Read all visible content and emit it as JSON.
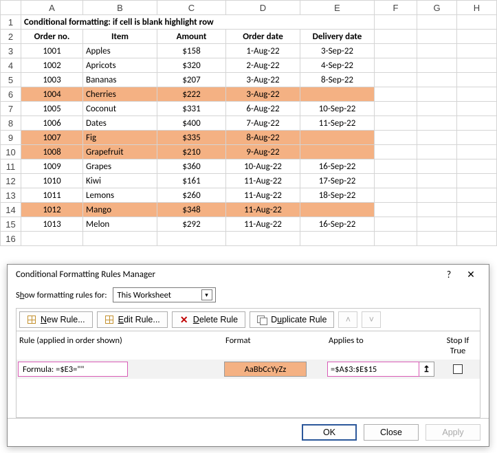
{
  "columns": [
    "A",
    "B",
    "C",
    "D",
    "E",
    "F",
    "G",
    "H"
  ],
  "title": "Conditional formatting: if cell is blank highlight row",
  "headers": {
    "order": "Order no.",
    "item": "Item",
    "amount": "Amount",
    "odate": "Order date",
    "ddate": "Delivery date"
  },
  "rows": [
    {
      "n": "3",
      "order": "1001",
      "item": "Apples",
      "amount": "$158",
      "odate": "1-Aug-22",
      "ddate": "3-Sep-22",
      "hl": false
    },
    {
      "n": "4",
      "order": "1002",
      "item": "Apricots",
      "amount": "$320",
      "odate": "2-Aug-22",
      "ddate": "4-Sep-22",
      "hl": false
    },
    {
      "n": "5",
      "order": "1003",
      "item": "Bananas",
      "amount": "$207",
      "odate": "3-Aug-22",
      "ddate": "8-Sep-22",
      "hl": false
    },
    {
      "n": "6",
      "order": "1004",
      "item": "Cherries",
      "amount": "$222",
      "odate": "3-Aug-22",
      "ddate": "",
      "hl": true
    },
    {
      "n": "7",
      "order": "1005",
      "item": "Coconut",
      "amount": "$331",
      "odate": "6-Aug-22",
      "ddate": "10-Sep-22",
      "hl": false
    },
    {
      "n": "8",
      "order": "1006",
      "item": "Dates",
      "amount": "$400",
      "odate": "7-Aug-22",
      "ddate": "11-Sep-22",
      "hl": false
    },
    {
      "n": "9",
      "order": "1007",
      "item": "Fig",
      "amount": "$335",
      "odate": "8-Aug-22",
      "ddate": "",
      "hl": true
    },
    {
      "n": "10",
      "order": "1008",
      "item": "Grapefruit",
      "amount": "$210",
      "odate": "9-Aug-22",
      "ddate": "",
      "hl": true
    },
    {
      "n": "11",
      "order": "1009",
      "item": "Grapes",
      "amount": "$360",
      "odate": "10-Aug-22",
      "ddate": "16-Sep-22",
      "hl": false
    },
    {
      "n": "12",
      "order": "1010",
      "item": "Kiwi",
      "amount": "$161",
      "odate": "11-Aug-22",
      "ddate": "17-Sep-22",
      "hl": false
    },
    {
      "n": "13",
      "order": "1011",
      "item": "Lemons",
      "amount": "$260",
      "odate": "11-Aug-22",
      "ddate": "18-Sep-22",
      "hl": false
    },
    {
      "n": "14",
      "order": "1012",
      "item": "Mango",
      "amount": "$348",
      "odate": "11-Aug-22",
      "ddate": "",
      "hl": true
    },
    {
      "n": "15",
      "order": "1013",
      "item": "Melon",
      "amount": "$292",
      "odate": "11-Aug-22",
      "ddate": "16-Sep-22",
      "hl": false
    }
  ],
  "extra_rows": [
    "16"
  ],
  "dialog": {
    "title": "Conditional Formatting Rules Manager",
    "show_label_pre": "S",
    "show_label_u": "h",
    "show_label_post": "ow formatting rules for:",
    "scope": "This Worksheet",
    "buttons": {
      "new_u": "N",
      "new_post": "ew Rule...",
      "edit_u": "E",
      "edit_post": "dit Rule...",
      "del_u": "D",
      "del_post": "elete Rule",
      "dup_pre": "D",
      "dup_u": "u",
      "dup_post": "plicate Rule"
    },
    "list_headers": {
      "rule": "Rule (applied in order shown)",
      "format": "Format",
      "applies": "Applies to",
      "stop": "Stop If True"
    },
    "rule": {
      "formula_label": "Formula: =$E3=\"\"",
      "preview": "AaBbCcYyZz",
      "applies": "=$A$3:$E$15"
    },
    "footer": {
      "ok": "OK",
      "close": "Close",
      "apply": "Apply"
    }
  }
}
